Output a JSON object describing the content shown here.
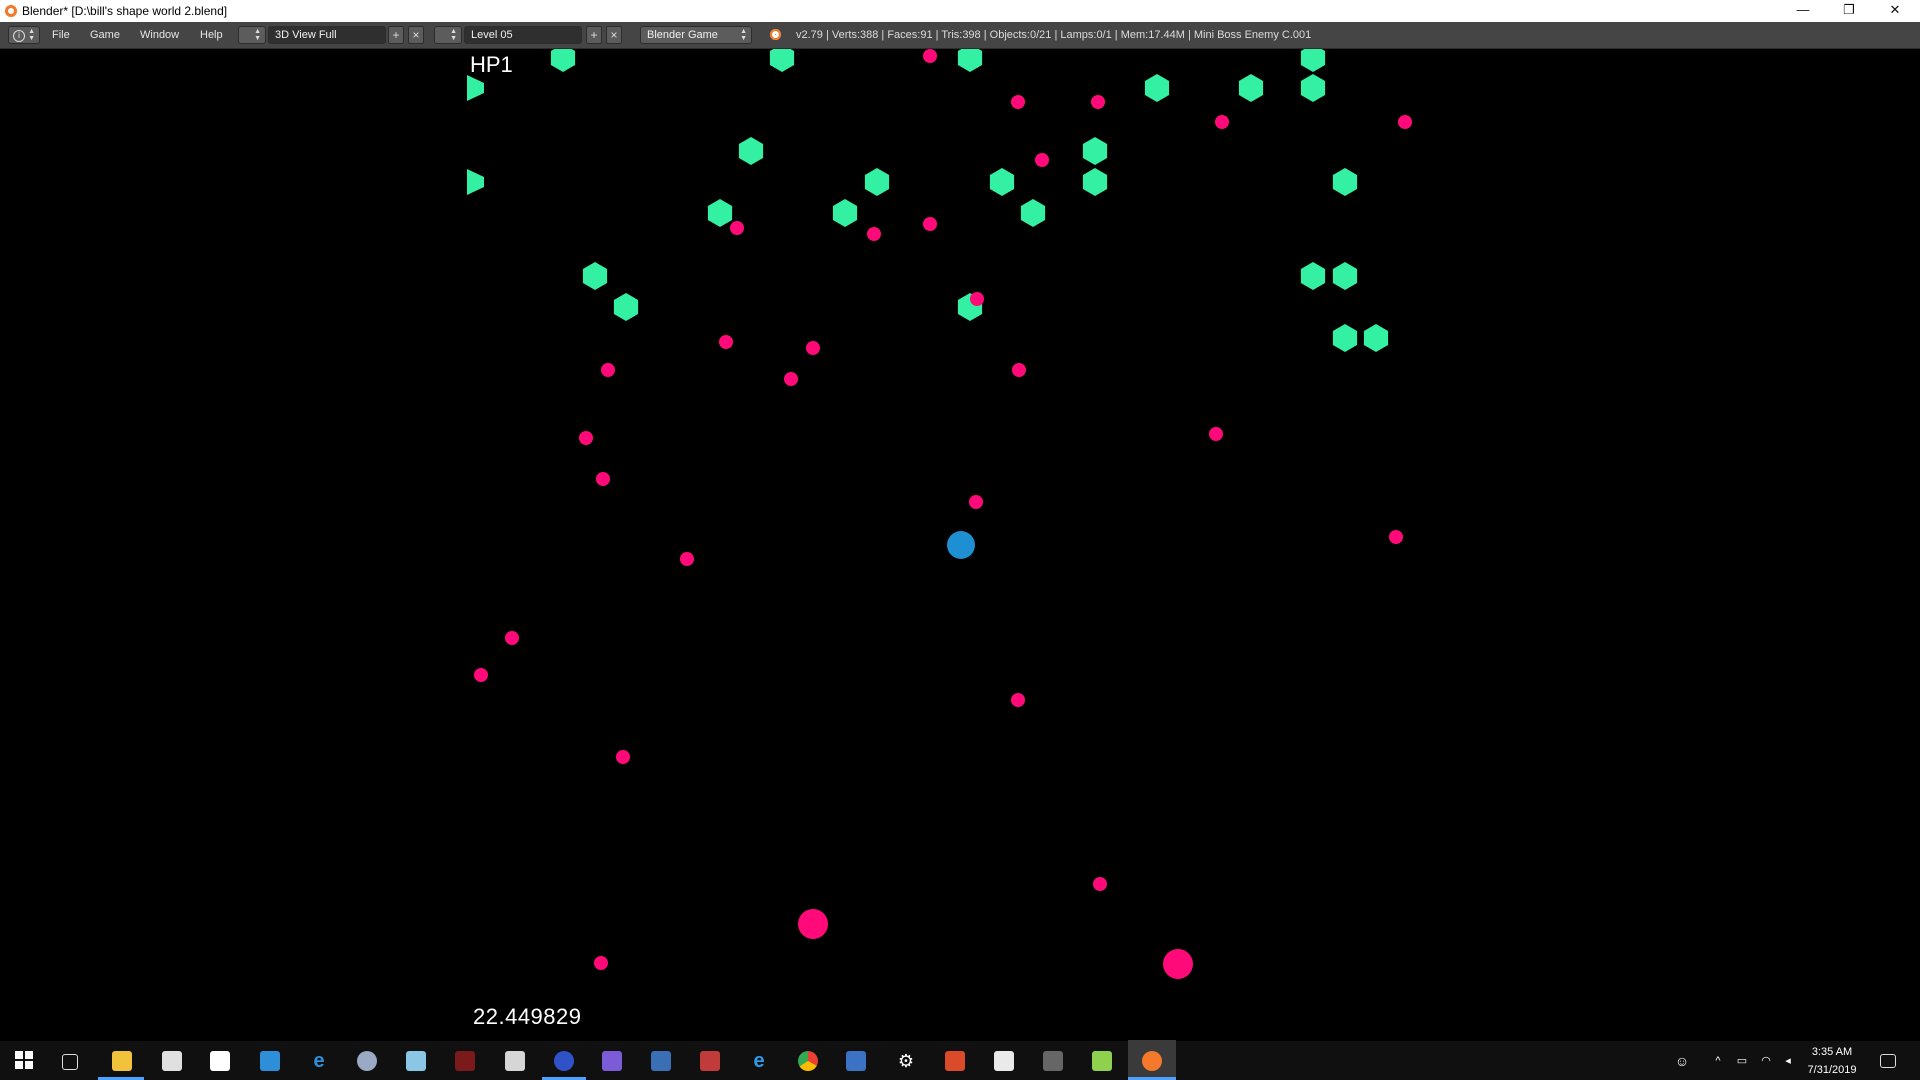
{
  "window": {
    "title": "Blender* [D:\\bill's shape world 2.blend]",
    "minimize": "—",
    "restore": "❐",
    "close": "✕"
  },
  "menubar": {
    "info_icon": "info-icon",
    "menus": [
      "File",
      "Game",
      "Window",
      "Help"
    ],
    "screen_layout": "3D View Full",
    "scene": "Level 05",
    "engine": "Blender Game",
    "stats": "v2.79 | Verts:388 | Faces:91 | Tris:398 | Objects:0/21 | Lamps:0/1 | Mem:17.44M | Mini Boss Enemy C.001"
  },
  "game": {
    "hp": "HP1",
    "timer": "22.449829",
    "colors": {
      "hexagon": "#33f0a2",
      "enemy": "#ff0a78",
      "player": "#1f8fd4",
      "background": "#000000"
    }
  },
  "taskbar": {
    "start_icon": "windows-start-icon",
    "icons": [
      "task-view-icon",
      "file-explorer-icon",
      "store-icon",
      "mail-icon",
      "photos-icon",
      "edge-icon",
      "paint-icon",
      "notepad-icon",
      "game-icon",
      "calculator-icon",
      "app-icon",
      "video-editor-icon",
      "remote-desktop-icon",
      "text-app-icon",
      "internet-explorer-icon",
      "chrome-icon",
      "paint-program-icon",
      "settings-icon",
      "office-icon",
      "installer-icon",
      "tool-icon",
      "utility-icon",
      "blender-icon"
    ],
    "time": "3:35 AM",
    "date": "7/31/2019"
  }
}
